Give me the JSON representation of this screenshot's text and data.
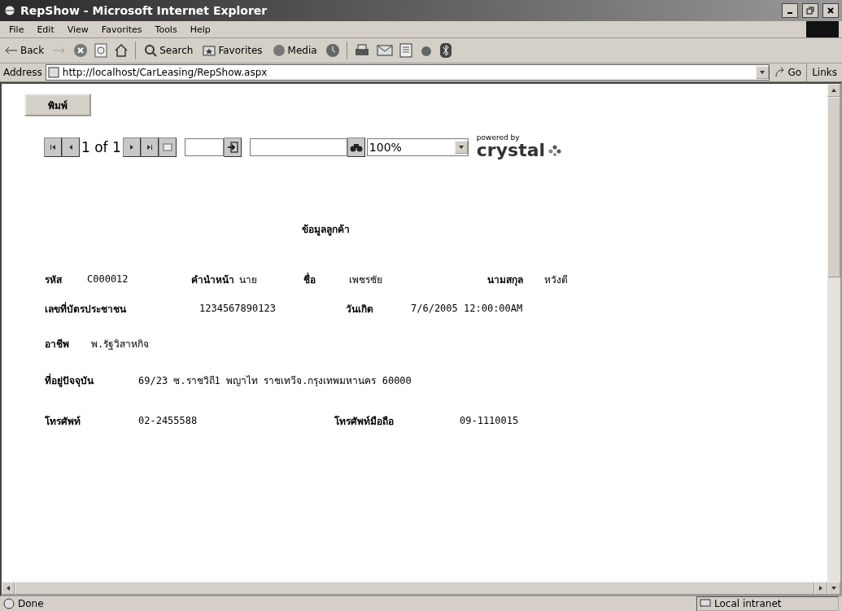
{
  "window": {
    "title": "RepShow - Microsoft Internet Explorer"
  },
  "menu": [
    "File",
    "Edit",
    "View",
    "Favorites",
    "Tools",
    "Help"
  ],
  "toolbar": {
    "back": "Back",
    "search": "Search",
    "favorites": "Favorites",
    "media": "Media"
  },
  "address_bar": {
    "label": "Address",
    "url": "http://localhost/CarLeasing/RepShow.aspx",
    "go": "Go",
    "links": "Links"
  },
  "print_button": "พิมพ์",
  "report_toolbar": {
    "page_info": "1 of 1",
    "zoom": "100%",
    "logo_small": "powered by",
    "logo": "crystal"
  },
  "report": {
    "title": "ข้อมูลลูกค้า",
    "rows": [
      [
        {
          "kind": "label",
          "text": "รหัส"
        },
        {
          "kind": "value",
          "text": "C000012"
        },
        {
          "kind": "label",
          "text": "คำนำหน้า"
        },
        {
          "kind": "value",
          "text": "นาย"
        },
        {
          "kind": "label",
          "text": "ชื่อ"
        },
        {
          "kind": "value",
          "text": "เพชรชัย"
        },
        {
          "kind": "label",
          "text": "นามสกุล"
        },
        {
          "kind": "value",
          "text": "หวังดี"
        }
      ],
      [
        {
          "kind": "label",
          "text": "เลขที่บัตรประชาชน"
        },
        {
          "kind": "value",
          "text": "1234567890123"
        },
        {
          "kind": "label",
          "text": "วันเกิด"
        },
        {
          "kind": "value",
          "text": "7/6/2005  12:00:00AM"
        }
      ],
      [
        {
          "kind": "label",
          "text": "อาชีพ"
        },
        {
          "kind": "value",
          "text": "พ.รัฐวิสาหกิจ"
        }
      ],
      [
        {
          "kind": "label",
          "text": "ที่อยู่ปัจจุบัน"
        },
        {
          "kind": "value",
          "text": "69/23 ซ.ราชวิถี1 พญาไท ราชเทวีจ.กรุงเทพมหานคร 60000"
        }
      ],
      [
        {
          "kind": "label",
          "text": "โทรศัพท์"
        },
        {
          "kind": "value",
          "text": "02-2455588"
        },
        {
          "kind": "label",
          "text": "โทรศัพท์มือถือ"
        },
        {
          "kind": "value",
          "text": "09-1110015"
        }
      ]
    ]
  },
  "status_bar": {
    "status": "Done",
    "zone": "Local intranet"
  }
}
